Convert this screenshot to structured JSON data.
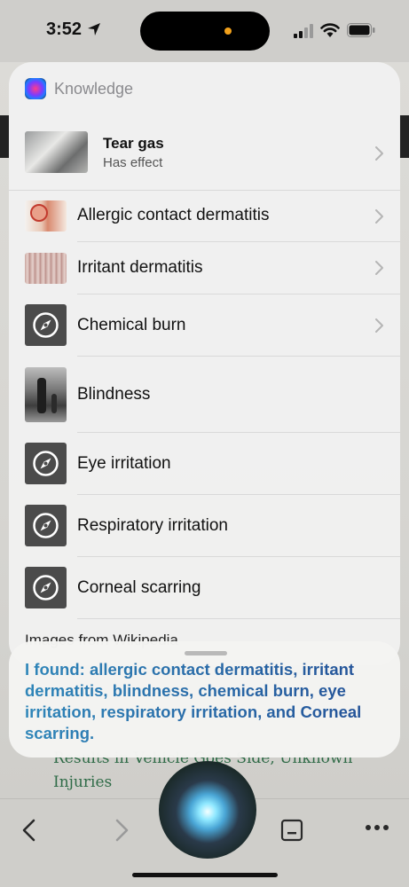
{
  "status_bar": {
    "time": "3:52"
  },
  "background": {
    "headline": "Results in Vehicle Goes Side, Unknown Injuries"
  },
  "knowledge_card": {
    "title": "Knowledge",
    "top_item": {
      "title": "Tear gas",
      "subtitle": "Has effect"
    },
    "items": [
      {
        "label": "Allergic contact dermatitis",
        "has_chevron": true
      },
      {
        "label": "Irritant dermatitis",
        "has_chevron": true
      },
      {
        "label": "Chemical burn",
        "has_chevron": true,
        "icon": "compass-icon"
      },
      {
        "label": "Blindness",
        "has_chevron": false
      },
      {
        "label": "Eye irritation",
        "has_chevron": false,
        "icon": "compass-icon"
      },
      {
        "label": "Respiratory irritation",
        "has_chevron": false,
        "icon": "compass-icon"
      },
      {
        "label": "Corneal scarring",
        "has_chevron": false,
        "icon": "compass-icon"
      }
    ],
    "footer_text": "Images from Wikipedia"
  },
  "siri_answer": {
    "text": "I found: allergic contact dermatitis, irritant dermatitis, blindness, chemical burn, eye irritation, respiratory irritation, and Corneal scarring."
  },
  "toolbar": {
    "icons": [
      "back-icon",
      "forward-icon",
      "siri-orb",
      "tabs-icon",
      "more-icon"
    ]
  },
  "colors": {
    "answer_gradient_start": "#2f86b9",
    "answer_gradient_end": "#234f96",
    "headline_green": "#2f6b47",
    "island_dot": "#f2a11b"
  }
}
